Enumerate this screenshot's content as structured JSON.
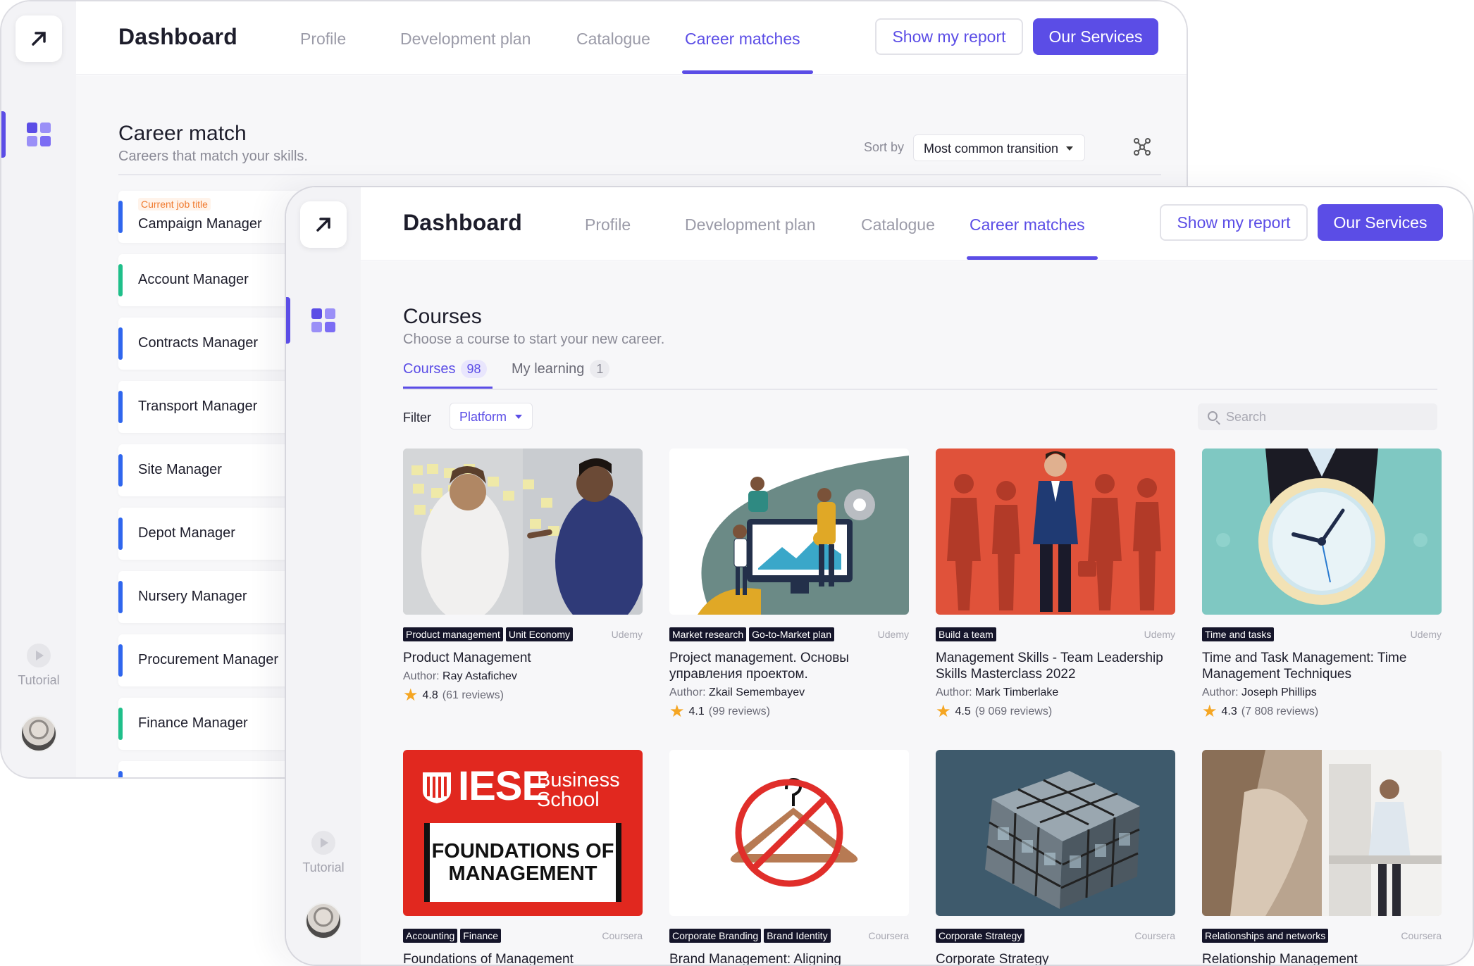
{
  "brand": "Dashboard",
  "nav": {
    "tabs": [
      "Profile",
      "Development plan",
      "Catalogue",
      "Career matches"
    ],
    "active_tab": "Career matches",
    "report_button": "Show my report",
    "services_button": "Our Services"
  },
  "sidebar": {
    "tutorial_label": "Tutorial"
  },
  "career_match": {
    "title": "Career match",
    "subtitle": "Careers that match your skills.",
    "sort_label": "Sort by",
    "sort_value": "Most common transition",
    "current_tag": "Current job title",
    "careers": [
      {
        "name": "Campaign Manager",
        "current": true,
        "sync": false
      },
      {
        "name": "Account Manager",
        "current": false,
        "sync": true
      },
      {
        "name": "Contracts Manager",
        "current": false,
        "sync": false
      },
      {
        "name": "Transport Manager",
        "current": false,
        "sync": false
      },
      {
        "name": "Site Manager",
        "current": false,
        "sync": false
      },
      {
        "name": "Depot Manager",
        "current": false,
        "sync": false
      },
      {
        "name": "Nursery Manager",
        "current": false,
        "sync": false
      },
      {
        "name": "Procurement Manager",
        "current": false,
        "sync": false
      },
      {
        "name": "Finance Manager",
        "current": false,
        "sync": true
      }
    ]
  },
  "courses": {
    "title": "Courses",
    "subtitle": "Choose a course to start your new career.",
    "tabs": [
      {
        "label": "Courses",
        "count": "98"
      },
      {
        "label": "My learning",
        "count": "1"
      }
    ],
    "filter_label": "Filter",
    "filter_value": "Platform",
    "search_placeholder": "Search",
    "author_label": "Author:",
    "items": [
      {
        "tags": [
          "Product management",
          "Unit Economy"
        ],
        "platform": "Udemy",
        "title": "Product Management",
        "author": "Ray Astafichev",
        "rating": "4.8",
        "reviews": "(61 reviews)",
        "image": "office-sticky-notes"
      },
      {
        "tags": [
          "Market research",
          "Go-to-Market plan"
        ],
        "platform": "Udemy",
        "title": "Project management. Основы управления проектом.",
        "author": "Zkail Semembayev",
        "rating": "4.1",
        "reviews": "(99 reviews)",
        "image": "teamwork-illustration"
      },
      {
        "tags": [
          "Build a team"
        ],
        "platform": "Udemy",
        "title": "Management Skills - Team Leadership Skills Masterclass 2022",
        "author": "Mark Timberlake",
        "rating": "4.5",
        "reviews": "(9 069 reviews)",
        "image": "leader-silhouettes"
      },
      {
        "tags": [
          "Time and tasks"
        ],
        "platform": "Udemy",
        "title": "Time and Task Management: Time Management Techniques",
        "author": "Joseph Phillips",
        "rating": "4.3",
        "reviews": "(7 808 reviews)",
        "image": "clock-illustration"
      },
      {
        "tags": [
          "Accounting",
          "Finance"
        ],
        "platform": "Coursera",
        "title": "Foundations of Management",
        "image": "iese-logo",
        "logo_line1": "IESE",
        "logo_line2": "Business",
        "logo_line3": "School",
        "banner1": "FOUNDATIONS OF",
        "banner2": "MANAGEMENT"
      },
      {
        "tags": [
          "Corporate Branding",
          "Brand Identity"
        ],
        "platform": "Coursera",
        "title": "Brand Management: Aligning",
        "image": "no-hanger"
      },
      {
        "tags": [
          "Corporate Strategy"
        ],
        "platform": "Coursera",
        "title": "Corporate Strategy",
        "image": "building-cube"
      },
      {
        "tags": [
          "Relationships and networks"
        ],
        "platform": "Coursera",
        "title": "Relationship Management",
        "image": "office-people"
      }
    ]
  },
  "colors": {
    "accent": "#5b4de6",
    "blue_bar": "#2f66ee",
    "green_bar": "#1fbf8a",
    "current_tag": "#f07a2e",
    "star": "#f5a623"
  }
}
